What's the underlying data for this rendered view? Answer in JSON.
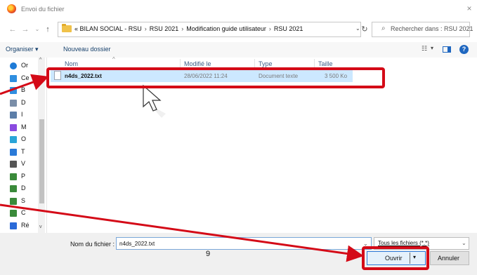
{
  "window": {
    "title": "Envoi du fichier",
    "close_label": "×"
  },
  "nav": {
    "back": "←",
    "forward": "→",
    "recent": "⌄",
    "up": "↑",
    "breadcrumb_overflow": "«",
    "breadcrumb": [
      "BILAN SOCIAL - RSU",
      "RSU 2021",
      "Modification guide utilisateur",
      "RSU 2021"
    ],
    "address_dropdown": "⌄",
    "refresh": "↻",
    "search_placeholder": "Rechercher dans : RSU 2021"
  },
  "toolbar": {
    "organize": "Organiser ▾",
    "new_folder": "Nouveau dossier",
    "view_menu": "▾"
  },
  "sidebar": {
    "items": [
      {
        "label": "Or",
        "icon": "cloud-icon",
        "color": "#1e7bd7"
      },
      {
        "label": "Ce",
        "icon": "computer-icon",
        "color": "#2f8ee0"
      },
      {
        "label": "B",
        "icon": "desktop-icon",
        "color": "#2f8ee0"
      },
      {
        "label": "D",
        "icon": "documents-icon",
        "color": "#7a8ea8"
      },
      {
        "label": "I",
        "icon": "images-icon",
        "color": "#5c7ea8"
      },
      {
        "label": "M",
        "icon": "music-icon",
        "color": "#8a4ae0"
      },
      {
        "label": "O",
        "icon": "objects-3d-icon",
        "color": "#2aa5d8"
      },
      {
        "label": "T",
        "icon": "downloads-icon",
        "color": "#2a7ad8"
      },
      {
        "label": "V",
        "icon": "videos-icon",
        "color": "#555555"
      },
      {
        "label": "P",
        "icon": "drive-icon",
        "color": "#3a8a3a"
      },
      {
        "label": "D",
        "icon": "drive-icon",
        "color": "#3a8a3a"
      },
      {
        "label": "S",
        "icon": "drive-icon",
        "color": "#3a8a3a"
      },
      {
        "label": "C",
        "icon": "drive-icon",
        "color": "#3a8a3a"
      },
      {
        "label": "Ré",
        "icon": "network-icon",
        "color": "#2a6ad8"
      }
    ]
  },
  "columns": {
    "name": "Nom",
    "modified": "Modifié le",
    "type": "Type",
    "size": "Taille"
  },
  "files": [
    {
      "name": "n4ds_2022.txt",
      "modified": "28/06/2022 11:24",
      "type": "Document texte",
      "size": "3 500 Ko"
    }
  ],
  "bottom": {
    "filename_label": "Nom du fichier :",
    "filename_value": "n4ds_2022.txt",
    "filter_value": "Tous les fichiers (*.*)",
    "page_number": "9",
    "open_label": "Ouvrir",
    "cancel_label": "Annuler"
  },
  "annotation": {
    "color": "#d40a17"
  }
}
